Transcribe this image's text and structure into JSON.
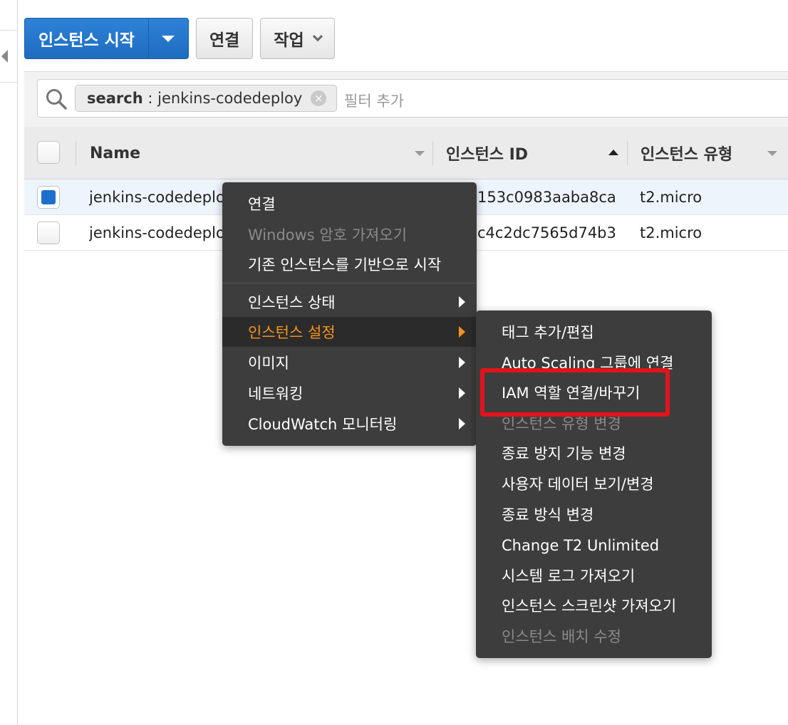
{
  "toolbar": {
    "launch_label": "인스턴스 시작",
    "connect_label": "연결",
    "actions_label": "작업"
  },
  "search": {
    "token_key": "search",
    "token_sep": " : ",
    "token_value": "jenkins-codedeploy",
    "token_remove": "×",
    "placeholder": "필터 추가"
  },
  "table": {
    "columns": [
      "Name",
      "인스턴스 ID",
      "인스턴스 유형"
    ],
    "rows": [
      {
        "name": "jenkins-codedeplo",
        "id": "153c0983aaba8ca",
        "type": "t2.micro",
        "selected": true
      },
      {
        "name": "jenkins-codedeplo",
        "id": "c4c2dc7565d74b3",
        "type": "t2.micro",
        "selected": false
      }
    ]
  },
  "context_menu": {
    "items": [
      {
        "label": "연결",
        "disabled": false
      },
      {
        "label": "Windows 암호 가져오기",
        "disabled": true
      },
      {
        "label": "기존 인스턴스를 기반으로 시작",
        "disabled": false
      },
      {
        "label": "인스턴스 상태",
        "submenu": true
      },
      {
        "label": "인스턴스 설정",
        "submenu": true,
        "active": true
      },
      {
        "label": "이미지",
        "submenu": true
      },
      {
        "label": "네트워킹",
        "submenu": true
      },
      {
        "label": "CloudWatch 모니터링",
        "submenu": true
      }
    ]
  },
  "submenu": {
    "items": [
      {
        "label": "태그 추가/편집",
        "disabled": false
      },
      {
        "label": "Auto Scaling 그룹에 연결",
        "disabled": false
      },
      {
        "label": "IAM 역할 연결/바꾸기",
        "disabled": false,
        "highlighted": true
      },
      {
        "label": "인스턴스 유형 변경",
        "disabled": true
      },
      {
        "label": "종료 방지 기능 변경",
        "disabled": false
      },
      {
        "label": "사용자 데이터 보기/변경",
        "disabled": false
      },
      {
        "label": "종료 방식 변경",
        "disabled": false
      },
      {
        "label": "Change T2 Unlimited",
        "disabled": false
      },
      {
        "label": "시스템 로그 가져오기",
        "disabled": false
      },
      {
        "label": "인스턴스 스크린샷 가져오기",
        "disabled": false
      },
      {
        "label": "인스턴스 배치 수정",
        "disabled": true
      }
    ]
  },
  "colors": {
    "primary_button": "#1f6cc0",
    "menu_background": "#3d3d3d",
    "menu_active_text": "#f7931e",
    "highlight_box": "#e1141b"
  }
}
